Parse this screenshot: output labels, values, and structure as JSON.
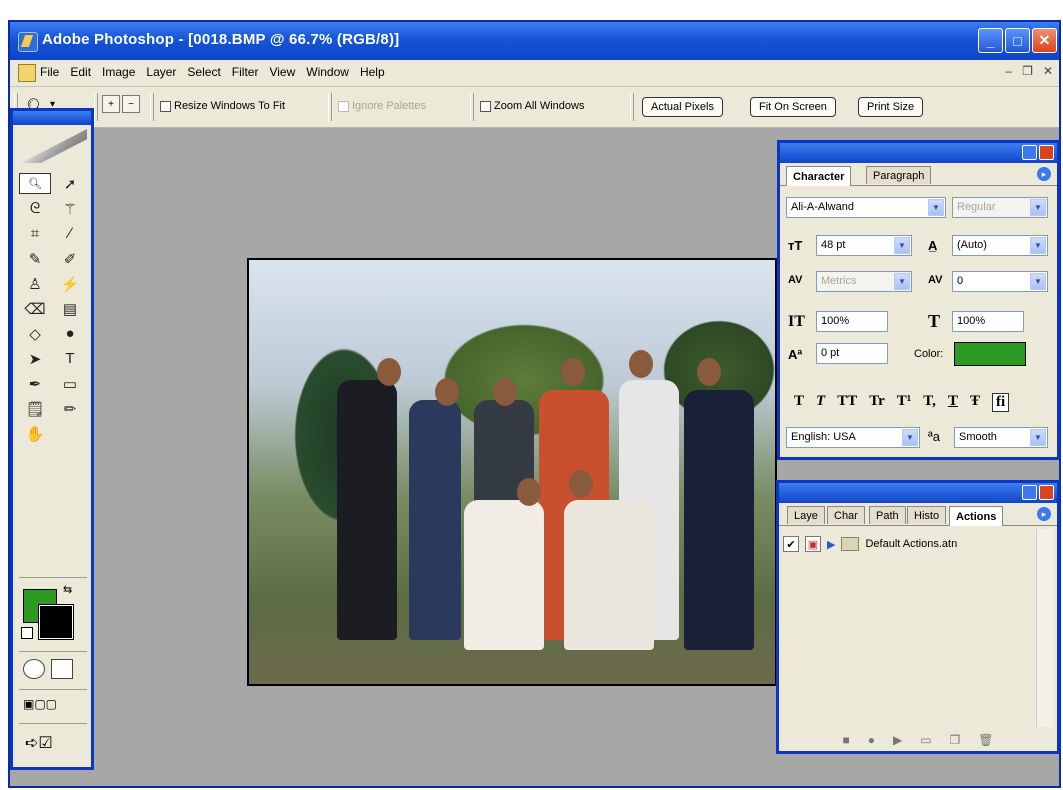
{
  "window": {
    "title": "Adobe Photoshop - [0018.BMP @ 66.7% (RGB/8)]"
  },
  "menubar": {
    "items": [
      "File",
      "Edit",
      "Image",
      "Layer",
      "Select",
      "Filter",
      "View",
      "Window",
      "Help"
    ]
  },
  "options": {
    "resize_windows": "Resize Windows To Fit",
    "ignore_palettes": "Ignore Palettes",
    "zoom_all": "Zoom All Windows",
    "actual_pixels": "Actual Pixels",
    "fit_on_screen": "Fit On Screen",
    "print_size": "Print Size"
  },
  "character": {
    "tabs": [
      "Character",
      "Paragraph"
    ],
    "font_family": "Ali-A-Alwand",
    "font_style": "Regular",
    "font_size": "48 pt",
    "leading": "(Auto)",
    "kerning": "Metrics",
    "tracking": "0",
    "vertical_scale": "100%",
    "horizontal_scale": "100%",
    "baseline_shift": "0 pt",
    "color_label": "Color:",
    "color": "#2c9a22",
    "language": "English: USA",
    "antialias": "Smooth",
    "style_buttons": [
      "T",
      "T",
      "TT",
      "Tr",
      "T¹",
      "T,",
      "T",
      "Ŧ",
      "fi"
    ]
  },
  "actions": {
    "tabs": [
      "Laye",
      "Char",
      "Path",
      "Histo",
      "Actions"
    ],
    "items": [
      {
        "name": "Default Actions.atn"
      }
    ]
  },
  "colors": {
    "foreground": "#2c9a22",
    "background": "#000000",
    "titlebar": "#1654d8",
    "workspace": "#a7a7a7"
  }
}
